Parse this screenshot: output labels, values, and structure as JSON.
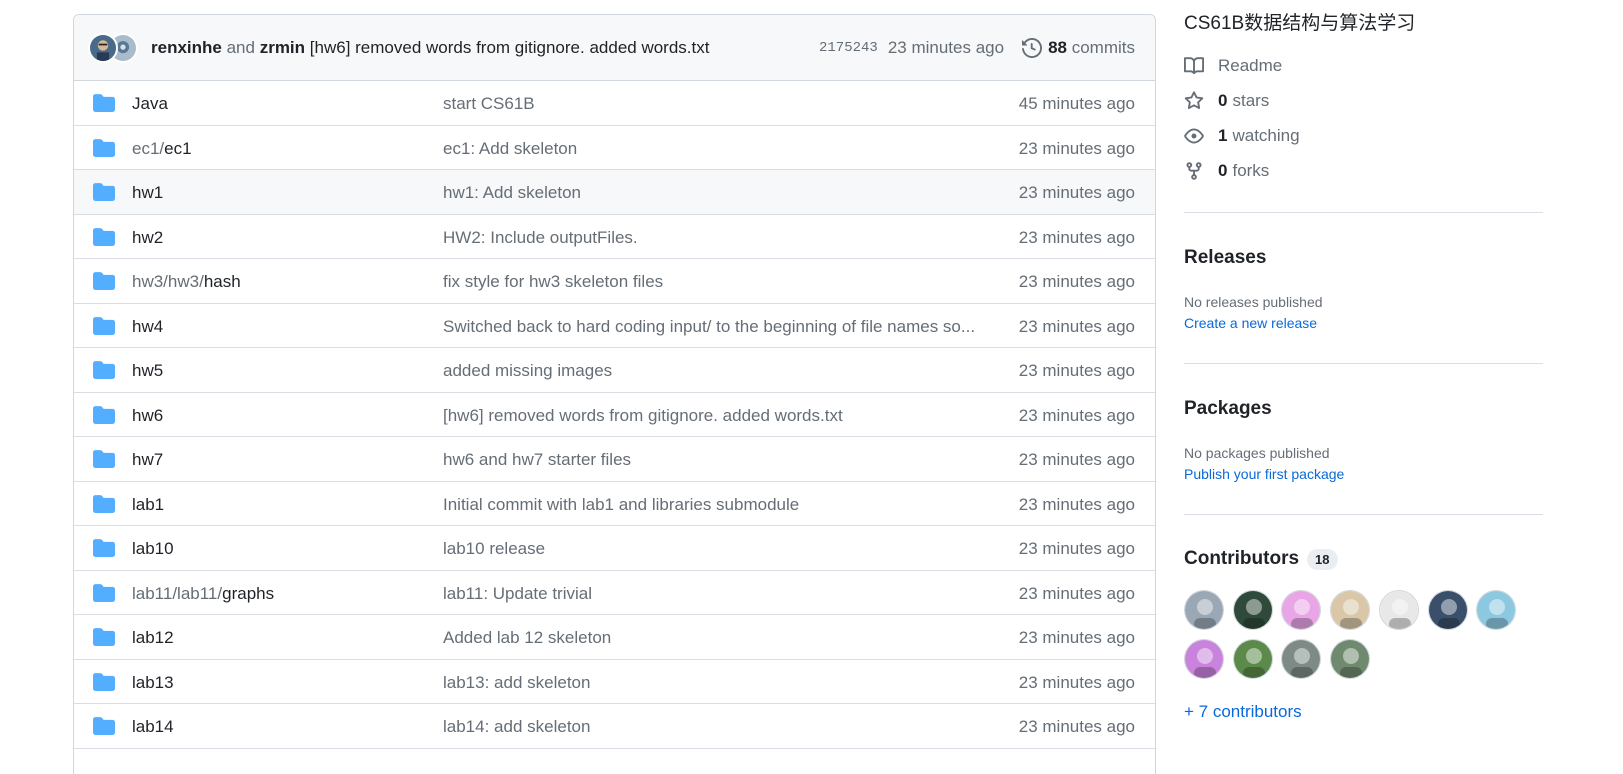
{
  "commit": {
    "author1": "renxinhe",
    "and": "and",
    "author2": "zrmin",
    "message": "[hw6] removed words from gitignore. added words.txt",
    "sha": "2175243",
    "time": "23 minutes ago",
    "commit_count": "88",
    "commits_label": "commits"
  },
  "files": [
    {
      "prefix": "",
      "name": "Java",
      "message": "start CS61B",
      "time": "45 minutes ago"
    },
    {
      "prefix": "ec1/",
      "name": "ec1",
      "message": "ec1: Add skeleton",
      "time": "23 minutes ago"
    },
    {
      "prefix": "",
      "name": "hw1",
      "message": "hw1: Add skeleton",
      "time": "23 minutes ago"
    },
    {
      "prefix": "",
      "name": "hw2",
      "message": "HW2: Include outputFiles.",
      "time": "23 minutes ago"
    },
    {
      "prefix": "hw3/hw3/",
      "name": "hash",
      "message": "fix style for hw3 skeleton files",
      "time": "23 minutes ago"
    },
    {
      "prefix": "",
      "name": "hw4",
      "message": "Switched back to hard coding input/ to the beginning of file names so...",
      "time": "23 minutes ago"
    },
    {
      "prefix": "",
      "name": "hw5",
      "message": "added missing images",
      "time": "23 minutes ago"
    },
    {
      "prefix": "",
      "name": "hw6",
      "message": "[hw6] removed words from gitignore. added words.txt",
      "time": "23 minutes ago"
    },
    {
      "prefix": "",
      "name": "hw7",
      "message": "hw6 and hw7 starter files",
      "time": "23 minutes ago"
    },
    {
      "prefix": "",
      "name": "lab1",
      "message": "Initial commit with lab1 and libraries submodule",
      "time": "23 minutes ago"
    },
    {
      "prefix": "",
      "name": "lab10",
      "message": "lab10 release",
      "time": "23 minutes ago"
    },
    {
      "prefix": "lab11/lab11/",
      "name": "graphs",
      "message": "lab11: Update trivial",
      "time": "23 minutes ago"
    },
    {
      "prefix": "",
      "name": "lab12",
      "message": "Added lab 12 skeleton",
      "time": "23 minutes ago"
    },
    {
      "prefix": "",
      "name": "lab13",
      "message": "lab13: add skeleton",
      "time": "23 minutes ago"
    },
    {
      "prefix": "",
      "name": "lab14",
      "message": "lab14: add skeleton",
      "time": "23 minutes ago"
    }
  ],
  "about": {
    "description": "CS61B数据结构与算法学习",
    "readme": "Readme",
    "stars_count": "0",
    "stars_label": "stars",
    "watching_count": "1",
    "watching_label": "watching",
    "forks_count": "0",
    "forks_label": "forks"
  },
  "releases": {
    "title": "Releases",
    "empty": "No releases published",
    "link": "Create a new release"
  },
  "packages": {
    "title": "Packages",
    "empty": "No packages published",
    "link": "Publish your first package"
  },
  "contributors": {
    "title": "Contributors",
    "count": "18",
    "more": "+ 7 contributors",
    "avatars": [
      "#9aa7b4",
      "#2f4a3a",
      "#e9a6e6",
      "#d9c7a8",
      "#e8e8e8",
      "#3a4f6a",
      "#8cc8e0",
      "#c983dc",
      "#5c8a4a",
      "#7d8a86",
      "#6f8a6f"
    ]
  },
  "colors": {
    "folder": "#54aeff",
    "link": "#0969da",
    "muted": "#656d76"
  }
}
